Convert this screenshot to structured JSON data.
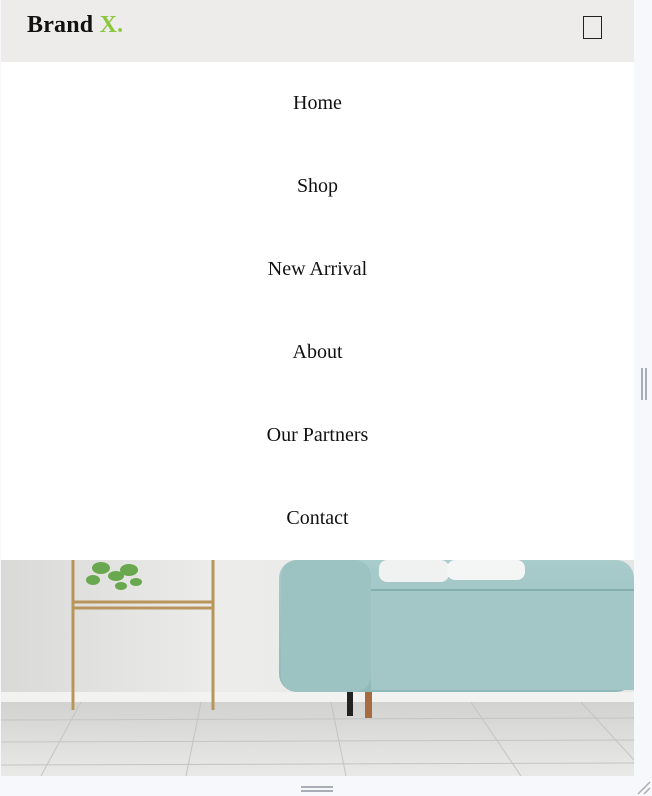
{
  "header": {
    "brand_name": "Brand",
    "brand_accent": "X.",
    "menu_toggle_icon": "hamburger-menu-icon"
  },
  "nav": {
    "items": [
      {
        "label": "Home"
      },
      {
        "label": "Shop"
      },
      {
        "label": "New Arrival"
      },
      {
        "label": "About"
      },
      {
        "label": "Our Partners"
      },
      {
        "label": "Contact"
      }
    ]
  },
  "colors": {
    "header_bg": "#edeceb",
    "brand_accent": "#8dc63f",
    "menu_bg": "#ffffff",
    "text": "#111111"
  },
  "hero": {
    "image_description_icon": "living-room-photo"
  }
}
